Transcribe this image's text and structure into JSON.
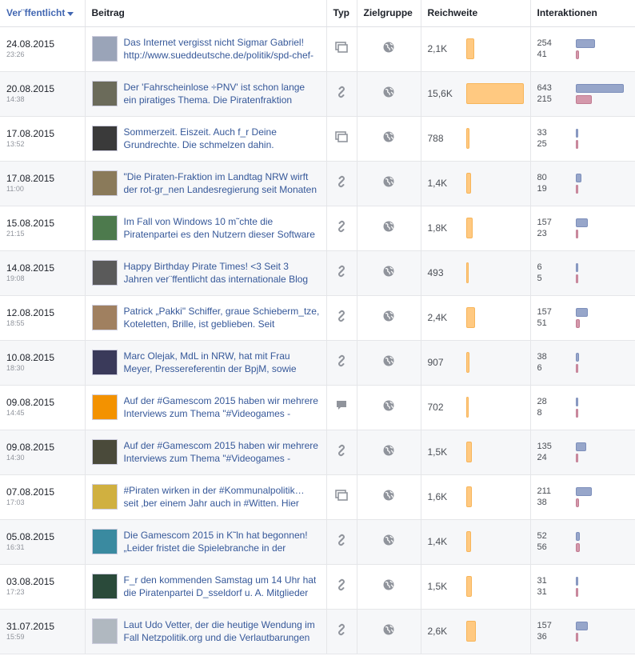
{
  "headers": {
    "published": "Ver¨ffentlicht",
    "post": "Beitrag",
    "type": "Typ",
    "audience": "Zielgruppe",
    "reach": "Reichweite",
    "interactions": "Interaktionen"
  },
  "rows": [
    {
      "date": "24.08.2015",
      "time": "23:26",
      "line1": "Das Internet vergisst nicht Sigmar Gabriel!",
      "line2": "http://www.sueddeutsche.de/politik/spd-chef-",
      "type": "status-icon",
      "reach": "2,1K",
      "reach_value": 2100,
      "i1": 254,
      "i2": 41,
      "thumb": "#9aa4b8"
    },
    {
      "date": "20.08.2015",
      "time": "14:38",
      "line1": "Der 'Fahrscheinlose ÷PNV' ist schon lange",
      "line2": "ein piratiges Thema. Die Piratenfraktion",
      "type": "link-icon",
      "reach": "15,6K",
      "reach_value": 15600,
      "i1": 643,
      "i2": 215,
      "thumb": "#6b6b5a"
    },
    {
      "date": "17.08.2015",
      "time": "13:52",
      "line1": "Sommerzeit. Eiszeit. Auch f_r Deine",
      "line2": "Grundrechte. Die schmelzen dahin.",
      "type": "status-icon",
      "reach": "788",
      "reach_value": 788,
      "i1": 33,
      "i2": 25,
      "thumb": "#3a3a3a"
    },
    {
      "date": "17.08.2015",
      "time": "11:00",
      "line1": "\"Die Piraten-Fraktion im Landtag NRW wirft",
      "line2": "der rot-gr_nen Landesregierung seit Monaten",
      "type": "link-icon",
      "reach": "1,4K",
      "reach_value": 1400,
      "i1": 80,
      "i2": 19,
      "thumb": "#8a7a5a"
    },
    {
      "date": "15.08.2015",
      "time": "21:15",
      "line1": "Im Fall von Windows 10 m˜chte die",
      "line2": "Piratenpartei es den Nutzern dieser Software",
      "type": "link-icon",
      "reach": "1,8K",
      "reach_value": 1800,
      "i1": 157,
      "i2": 23,
      "thumb": "#4d7a4d"
    },
    {
      "date": "14.08.2015",
      "time": "19:08",
      "line1": "Happy Birthday Pirate Times! <3 Seit 3",
      "line2": "Jahren ver¨ffentlicht das internationale Blog",
      "type": "link-icon",
      "reach": "493",
      "reach_value": 493,
      "i1": 6,
      "i2": 5,
      "thumb": "#5a5a5a"
    },
    {
      "date": "12.08.2015",
      "time": "18:55",
      "line1": "Patrick „Pakki\" Schiffer, graue Schieberm_tze,",
      "line2": "Koteletten, Brille, ist geblieben. Seit",
      "type": "link-icon",
      "reach": "2,4K",
      "reach_value": 2400,
      "i1": 157,
      "i2": 51,
      "thumb": "#a08060"
    },
    {
      "date": "10.08.2015",
      "time": "18:30",
      "line1": "Marc Olejak, MdL in NRW, hat mit Frau",
      "line2": "Meyer, Pressereferentin der BpjM, sowie",
      "type": "link-icon",
      "reach": "907",
      "reach_value": 907,
      "i1": 38,
      "i2": 6,
      "thumb": "#3a3a5a"
    },
    {
      "date": "09.08.2015",
      "time": "14:45",
      "line1": "Auf der #Gamescom 2015 haben wir mehrere",
      "line2": "Interviews zum Thema \"#Videogames -",
      "type": "comment-icon",
      "reach": "702",
      "reach_value": 702,
      "i1": 28,
      "i2": 8,
      "thumb": "#f39200"
    },
    {
      "date": "09.08.2015",
      "time": "14:30",
      "line1": "Auf der #Gamescom 2015 haben wir mehrere",
      "line2": "Interviews zum Thema \"#Videogames -",
      "type": "link-icon",
      "reach": "1,5K",
      "reach_value": 1500,
      "i1": 135,
      "i2": 24,
      "thumb": "#4a4a3a"
    },
    {
      "date": "07.08.2015",
      "time": "17:03",
      "line1": "#Piraten wirken in der #Kommunalpolitik…",
      "line2": "seit ‚ber einem Jahr auch in #Witten. Hier",
      "type": "status-icon",
      "reach": "1,6K",
      "reach_value": 1600,
      "i1": 211,
      "i2": 38,
      "thumb": "#d0b040"
    },
    {
      "date": "05.08.2015",
      "time": "16:31",
      "line1": "Die Gamescom 2015 in K˜ln hat begonnen!",
      "line2": "„Leider fristet die Spielebranche in der",
      "type": "link-icon",
      "reach": "1,4K",
      "reach_value": 1400,
      "i1": 52,
      "i2": 56,
      "thumb": "#3a8aa0"
    },
    {
      "date": "03.08.2015",
      "time": "17:23",
      "line1": "F_r den kommenden Samstag um 14 Uhr hat",
      "line2": "die Piratenpartei D_sseldorf u. A. Mitglieder",
      "type": "link-icon",
      "reach": "1,5K",
      "reach_value": 1500,
      "i1": 31,
      "i2": 31,
      "thumb": "#2a4a3a"
    },
    {
      "date": "31.07.2015",
      "time": "15:59",
      "line1": "Laut Udo Vetter, der die heutige Wendung im",
      "line2": "Fall Netzpolitik.org und die Verlautbarungen",
      "type": "link-icon",
      "reach": "2,6K",
      "reach_value": 2600,
      "i1": 157,
      "i2": 36,
      "thumb": "#b0b8c0"
    }
  ],
  "colors": {
    "reach_bar": "#ffc981",
    "interaction_bar_1": "#97a6ca",
    "interaction_bar_2": "#d498ab",
    "link": "#365899"
  }
}
